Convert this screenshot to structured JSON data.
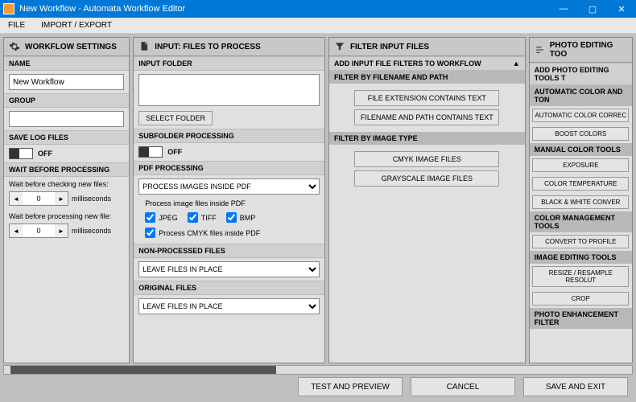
{
  "window": {
    "title": "New Workflow - Automata Workflow Editor"
  },
  "menu": {
    "file": "FILE",
    "import_export": "IMPORT / EXPORT"
  },
  "col1": {
    "title": "WORKFLOW SETTINGS",
    "name_label": "NAME",
    "name_value": "New Workflow",
    "group_label": "GROUP",
    "group_value": "",
    "save_log_label": "SAVE LOG FILES",
    "save_log_state": "OFF",
    "wait_before_label": "WAIT BEFORE PROCESSING",
    "wait_check_label": "Wait before checking new files:",
    "wait_check_value": "0",
    "wait_check_unit": "milliseconds",
    "wait_proc_label": "Wait before processing new file:",
    "wait_proc_value": "0",
    "wait_proc_unit": "milliseconds"
  },
  "col2": {
    "title": "INPUT: FILES TO PROCESS",
    "input_folder_label": "INPUT FOLDER",
    "select_folder_btn": "SELECT FOLDER",
    "subfolder_label": "SUBFOLDER PROCESSING",
    "subfolder_state": "OFF",
    "pdf_label": "PDF PROCESSING",
    "pdf_select": "PROCESS IMAGES INSIDE PDF",
    "pdf_filetypes_label": "Process image files inside PDF",
    "jpeg": "JPEG",
    "tiff": "TIFF",
    "bmp": "BMP",
    "cmyk_pdf": "Process CMYK files inside PDF",
    "nonproc_label": "NON-PROCESSED FILES",
    "nonproc_select": "LEAVE FILES IN PLACE",
    "orig_label": "ORIGINAL FILES",
    "orig_select": "LEAVE FILES IN PLACE"
  },
  "col3": {
    "title": "FILTER INPUT FILES",
    "add_filters": "ADD INPUT FILE FILTERS TO WORKFLOW",
    "by_name": "FILTER BY FILENAME AND PATH",
    "ext_btn": "FILE EXTENSION CONTAINS TEXT",
    "path_btn": "FILENAME AND PATH CONTAINS TEXT",
    "by_type": "FILTER BY IMAGE TYPE",
    "cmyk_btn": "CMYK IMAGE FILES",
    "gray_btn": "GRAYSCALE IMAGE FILES"
  },
  "col4": {
    "title": "PHOTO EDITING TOO",
    "add_tools": "ADD PHOTO EDITING TOOLS T",
    "auto_tone": "AUTOMATIC COLOR AND TON",
    "auto_correct": "AUTOMATIC COLOR CORREC",
    "boost": "BOOST COLORS",
    "manual": "MANUAL COLOR TOOLS",
    "exposure": "EXPOSURE",
    "colortemp": "COLOR TEMPERATURE",
    "bw": "BLACK & WHITE CONVER",
    "cm": "COLOR MANAGEMENT TOOLS",
    "convert": "CONVERT TO PROFILE",
    "editing": "IMAGE EDITING TOOLS",
    "resize": "RESIZE / RESAMPLE RESOLUT",
    "crop": "CROP",
    "enhance": "PHOTO ENHANCEMENT FILTER"
  },
  "footer": {
    "test": "TEST AND PREVIEW",
    "cancel": "CANCEL",
    "save": "SAVE AND EXIT"
  }
}
